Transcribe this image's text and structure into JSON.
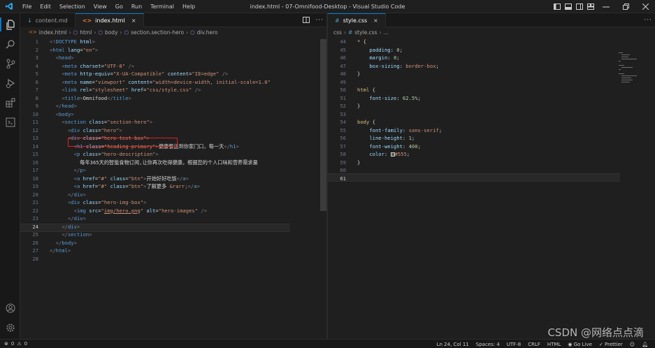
{
  "window": {
    "title": "index.html - 07-Omnifood-Desktop - Visual Studio Code",
    "menu": [
      "File",
      "Edit",
      "Selection",
      "View",
      "Go",
      "Run",
      "Terminal",
      "Help"
    ]
  },
  "left_editor": {
    "tabs": [
      {
        "label": "content.md",
        "icon": "markdown-icon",
        "active": false
      },
      {
        "label": "index.html",
        "icon": "html-icon",
        "active": true,
        "close": "×"
      }
    ],
    "breadcrumb": [
      "index.html",
      "html",
      "body",
      "section.section-hero",
      "div.hero"
    ],
    "lines": [
      {
        "n": "1",
        "html": "<span class='t-punc'>&lt;!</span><span class='t-tag'>DOCTYPE</span> <span class='t-attr'>html</span><span class='t-punc'>&gt;</span>"
      },
      {
        "n": "2",
        "html": "<span class='t-punc'>&lt;</span><span class='t-tag'>html</span> <span class='t-attr'>lang</span><span class='t-txt'>=</span><span class='t-str'>\"en\"</span><span class='t-punc'>&gt;</span>"
      },
      {
        "n": "3",
        "html": "  <span class='t-punc'>&lt;</span><span class='t-tag'>head</span><span class='t-punc'>&gt;</span>"
      },
      {
        "n": "4",
        "html": "    <span class='t-punc'>&lt;</span><span class='t-tag'>meta</span> <span class='t-attr'>charset</span><span class='t-txt'>=</span><span class='t-str'>\"UTF-8\"</span> <span class='t-punc'>/&gt;</span>"
      },
      {
        "n": "5",
        "html": "    <span class='t-punc'>&lt;</span><span class='t-tag'>meta</span> <span class='t-attr'>http-equiv</span><span class='t-txt'>=</span><span class='t-str'>\"X-UA-Compatible\"</span> <span class='t-attr'>content</span><span class='t-txt'>=</span><span class='t-str'>\"IE=edge\"</span> <span class='t-punc'>/&gt;</span>"
      },
      {
        "n": "6",
        "html": "    <span class='t-punc'>&lt;</span><span class='t-tag'>meta</span> <span class='t-attr'>name</span><span class='t-txt'>=</span><span class='t-str'>\"viewport\"</span> <span class='t-attr'>content</span><span class='t-txt'>=</span><span class='t-str'>\"width=device-width, initial-scale=1.0\"</span>"
      },
      {
        "n": "7",
        "html": "    <span class='t-punc'>&lt;</span><span class='t-tag'>link</span> <span class='t-attr'>rel</span><span class='t-txt'>=</span><span class='t-str'>\"stylesheet\"</span> <span class='t-attr'>href</span><span class='t-txt'>=</span><span class='t-str'>\"css/style.css\"</span> <span class='t-punc'>/&gt;</span>"
      },
      {
        "n": "8",
        "html": "    <span class='t-punc'>&lt;</span><span class='t-tag'>title</span><span class='t-punc'>&gt;</span><span class='t-txt'>Omnifood</span><span class='t-punc'>&lt;/</span><span class='t-tag'>title</span><span class='t-punc'>&gt;</span>"
      },
      {
        "n": "9",
        "html": "  <span class='t-punc'>&lt;/</span><span class='t-tag'>head</span><span class='t-punc'>&gt;</span>"
      },
      {
        "n": "10",
        "html": "  <span class='t-punc'>&lt;</span><span class='t-tag'>body</span><span class='t-punc'>&gt;</span>"
      },
      {
        "n": "11",
        "html": "    <span class='t-punc'>&lt;</span><span class='t-tag'>section</span> <span class='t-attr'>class</span><span class='t-txt'>=</span><span class='t-str'>\"section-hero\"</span><span class='t-punc'>&gt;</span>"
      },
      {
        "n": "12",
        "html": "      <span class='t-punc'>&lt;</span><span class='t-tag'>div</span> <span class='t-attr'>class</span><span class='t-txt'>=</span><span class='t-str'>\"hero\"</span><span class='t-punc'>&gt;</span>"
      },
      {
        "n": "13",
        "html": "      <span class='t-punc'>&lt;</span><span class='t-tag'>div</span> <span class='t-attr'>class</span><span class='t-txt'>=</span><span class='t-str'>\"hero-text-box\"</span><span class='t-punc'>&gt;</span>"
      },
      {
        "n": "14",
        "html": "        <span class='t-punc'>&lt;</span><span class='t-tag'>h1</span> <span class='t-attr'>class</span><span class='t-txt'>=</span><span class='t-str'>\"heading-primary\"</span><span class='t-punc'>&gt;</span><span class='t-txt'>健康餐送到你家门口，每一天</span><span class='t-punc'>&lt;/</span><span class='t-tag'>h1</span><span class='t-punc'>&gt;</span>"
      },
      {
        "n": "15",
        "html": "        <span class='t-punc'>&lt;</span><span class='t-tag'>p</span> <span class='t-attr'>class</span><span class='t-txt'>=</span><span class='t-str'>\"hero-description\"</span><span class='t-punc'>&gt;</span>"
      },
      {
        "n": "16",
        "html": "          <span class='t-txt'>每年365天的智能食物订阅,让你再次吃得健康。根据您的个人口味和营养需求量</span>"
      },
      {
        "n": "17",
        "html": "        <span class='t-punc'>&lt;/</span><span class='t-tag'>p</span><span class='t-punc'>&gt;</span>"
      },
      {
        "n": "18",
        "html": "        <span class='t-punc'>&lt;</span><span class='t-tag'>a</span> <span class='t-attr'>href</span><span class='t-txt'>=</span><span class='t-str'>\"#\"</span> <span class='t-attr'>class</span><span class='t-txt'>=</span><span class='t-str'>\"btn\"</span><span class='t-punc'>&gt;</span><span class='t-txt'>开始好好吃饭</span><span class='t-punc'>&lt;/</span><span class='t-tag'>a</span><span class='t-punc'>&gt;</span>"
      },
      {
        "n": "19",
        "html": "        <span class='t-punc'>&lt;</span><span class='t-tag'>a</span> <span class='t-attr'>href</span><span class='t-txt'>=</span><span class='t-str'>\"#\"</span> <span class='t-attr'>class</span><span class='t-txt'>=</span><span class='t-str'>\"btn\"</span><span class='t-punc'>&gt;</span><span class='t-txt'>了解更多 </span><span class='t-str'>&amp;rarr;</span><span class='t-punc'>&lt;/</span><span class='t-tag'>a</span><span class='t-punc'>&gt;</span>"
      },
      {
        "n": "20",
        "html": "      <span class='t-punc'>&lt;/</span><span class='t-tag'>div</span><span class='t-punc'>&gt;</span>"
      },
      {
        "n": "21",
        "html": "      <span class='t-punc'>&lt;</span><span class='t-tag'>div</span> <span class='t-attr'>class</span><span class='t-txt'>=</span><span class='t-str'>\"hero-img-box\"</span><span class='t-punc'>&gt;</span>"
      },
      {
        "n": "22",
        "html": "        <span class='t-punc'>&lt;</span><span class='t-tag'>img</span> <span class='t-attr'>src</span><span class='t-txt'>=</span><span class='t-str'>\"<u>img/hero.png</u>\"</span> <span class='t-attr'>alt</span><span class='t-txt'>=</span><span class='t-str'>\"hero-images\"</span> <span class='t-punc'>/&gt;</span>"
      },
      {
        "n": "23",
        "html": "      <span class='t-punc'>&lt;/</span><span class='t-tag'>div</span><span class='t-punc'>&gt;</span>"
      },
      {
        "n": "24",
        "html": "    <span class='t-punc'>&lt;/</span><span class='t-tag'>div</span><span class='t-punc'>&gt;</span>"
      },
      {
        "n": "25",
        "html": "    <span class='t-punc'>&lt;/</span><span class='t-tag'>section</span><span class='t-punc'>&gt;</span>"
      },
      {
        "n": "26",
        "html": "  <span class='t-punc'>&lt;/</span><span class='t-tag'>body</span><span class='t-punc'>&gt;</span>"
      },
      {
        "n": "27",
        "html": "<span class='t-punc'>&lt;/</span><span class='t-tag'>html</span><span class='t-punc'>&gt;</span>"
      },
      {
        "n": "28",
        "html": ""
      }
    ],
    "current_line": "24"
  },
  "right_editor": {
    "tabs": [
      {
        "label": "style.css",
        "icon": "css-icon",
        "active": true,
        "close": "×"
      }
    ],
    "breadcrumb": [
      "css",
      "style.css",
      "..."
    ],
    "lines": [
      {
        "n": "44",
        "html": "<span class='t-sel'>*</span> <span class='t-txt'>{</span>"
      },
      {
        "n": "45",
        "html": "    <span class='t-prop'>padding</span><span class='t-txt'>: </span><span class='t-num'>0</span><span class='t-txt'>;</span>"
      },
      {
        "n": "46",
        "html": "    <span class='t-prop'>margin</span><span class='t-txt'>: </span><span class='t-num'>0</span><span class='t-txt'>;</span>"
      },
      {
        "n": "47",
        "html": "    <span class='t-prop'>box-sizing</span><span class='t-txt'>: </span><span class='t-val'>border-box</span><span class='t-txt'>;</span>"
      },
      {
        "n": "48",
        "html": "<span class='t-txt'>}</span>"
      },
      {
        "n": "49",
        "html": ""
      },
      {
        "n": "50",
        "html": "<span class='t-sel'>html</span> <span class='t-txt'>{</span>"
      },
      {
        "n": "51",
        "html": "    <span class='t-prop'>font-size</span><span class='t-txt'>: </span><span class='t-num'>62.5%</span><span class='t-txt'>;</span>"
      },
      {
        "n": "52",
        "html": "<span class='t-txt'>}</span>"
      },
      {
        "n": "53",
        "html": ""
      },
      {
        "n": "54",
        "html": "<span class='t-sel'>body</span> <span class='t-txt'>{</span>"
      },
      {
        "n": "55",
        "html": "    <span class='t-prop'>font-family</span><span class='t-txt'>: </span><span class='t-val'>sans-serif</span><span class='t-txt'>;</span>"
      },
      {
        "n": "56",
        "html": "    <span class='t-prop'>line-height</span><span class='t-txt'>: </span><span class='t-num'>1</span><span class='t-txt'>;</span>"
      },
      {
        "n": "57",
        "html": "    <span class='t-prop'>font-weight</span><span class='t-txt'>: </span><span class='t-num'>400</span><span class='t-txt'>;</span>"
      },
      {
        "n": "58",
        "html": "    <span class='t-prop'>color</span><span class='t-txt'>: </span><span style='display:inline-block;width:6px;height:6px;background:#555;border:1px solid #ccc;vertical-align:middle'></span><span class='t-val'>#555</span><span class='t-txt'>;</span>"
      },
      {
        "n": "59",
        "html": "<span class='t-txt'>}</span>"
      },
      {
        "n": "60",
        "html": ""
      },
      {
        "n": "61",
        "html": ""
      }
    ],
    "current_line": "61"
  },
  "status": {
    "errors": "0",
    "warnings": "0",
    "position": "Ln 24, Col 11",
    "spaces": "Spaces: 4",
    "encoding": "UTF-8",
    "eol": "CRLF",
    "language": "HTML",
    "golive": "Go Live",
    "prettier": "Prettier"
  },
  "watermark": "CSDN @网络点点滴",
  "colors": {
    "accent": "#0078d4",
    "highlight_box": "#e02020",
    "background": "#1f1f1f"
  }
}
